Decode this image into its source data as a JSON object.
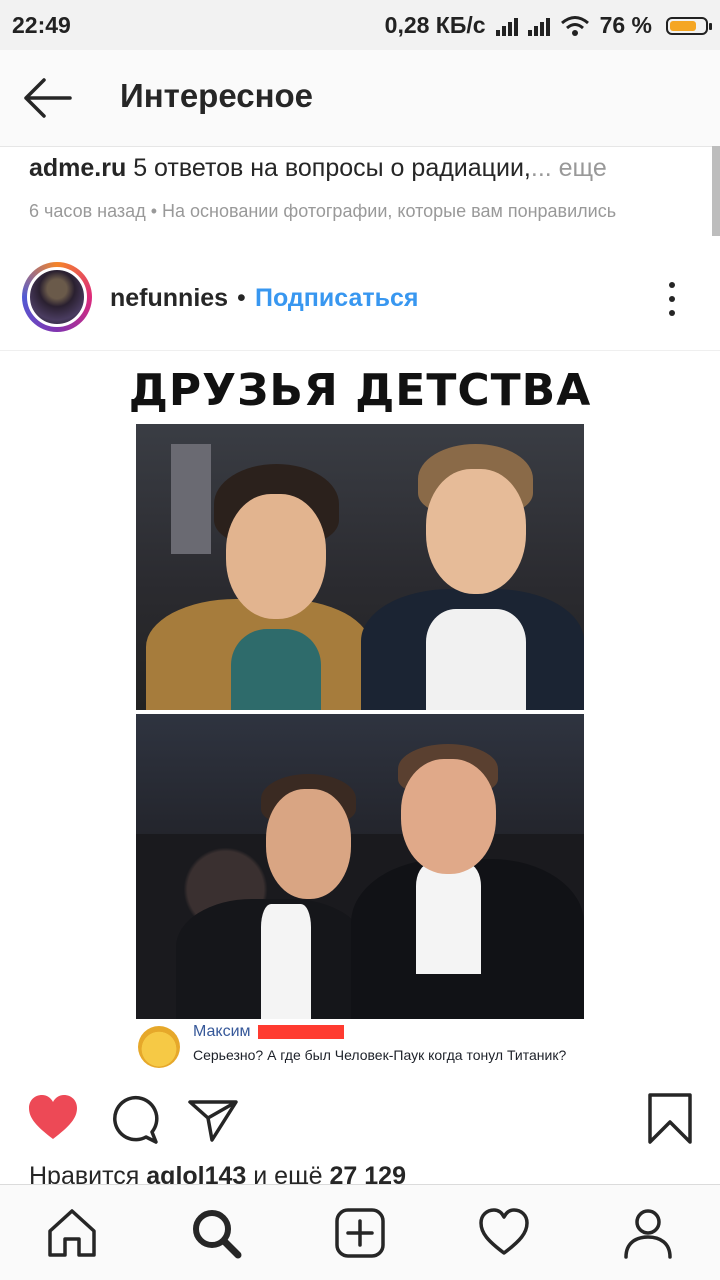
{
  "status_bar": {
    "time": "22:49",
    "network_speed": "0,28 КБ/с",
    "battery_percent": "76 %",
    "battery_level": 0.76,
    "battery_color": "#f5a623"
  },
  "header": {
    "back_icon": "arrow-left-icon",
    "title": "Интересное"
  },
  "notice": {
    "source": "adme.ru",
    "text": " 5 ответов на вопросы о радиации,",
    "more": "... еще",
    "meta": "6 часов назад • На основании фотографии, которые вам понравились"
  },
  "post": {
    "username": "nefunnies",
    "separator": "•",
    "follow_label": "Подписаться",
    "follow_color": "#3897f0",
    "more_icon": "more-vertical-icon",
    "image": {
      "title": "ДРУЗЬЯ ДЕТСТВА",
      "comment_author": "Максим",
      "comment_text": "Серьезно? А где был Человек-Паук когда тонул Титаник?"
    },
    "actions": {
      "like_icon": "heart-filled-icon",
      "like_color": "#ed4956",
      "comment_icon": "comment-icon",
      "share_icon": "send-icon",
      "save_icon": "bookmark-icon"
    },
    "likes": {
      "prefix": "Нравится ",
      "user": "aglol143",
      "middle": " и ещё ",
      "count": "27 129"
    }
  },
  "bottom_nav": {
    "items": [
      "home-icon",
      "search-icon",
      "add-post-icon",
      "activity-heart-icon",
      "profile-icon"
    ]
  }
}
